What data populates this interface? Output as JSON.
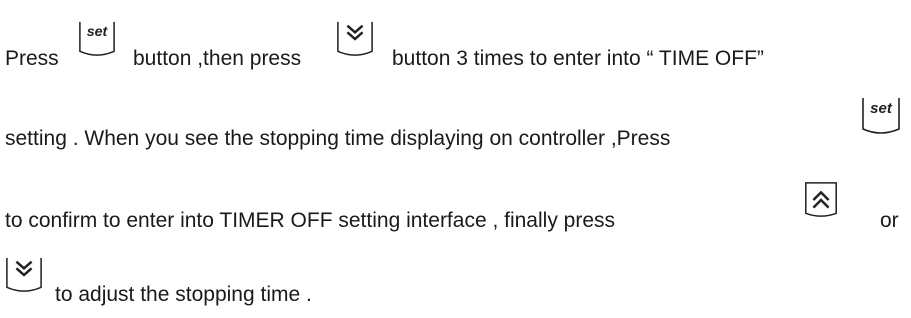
{
  "instruction": {
    "line1_part1": "Press",
    "line1_part2": "button ,then press",
    "line1_part3": "button 3 times to enter into “ TIME OFF”",
    "line2_part1": "setting . When you see the stopping time displaying on controller ,Press",
    "line3_part1": "to confirm to enter into TIMER OFF setting interface , finally press",
    "line3_part2": "or",
    "line4_part1": "to adjust the stopping time ."
  },
  "keys": {
    "set_label": "set",
    "set_icon": "set-key-icon",
    "down_icon": "double-chevron-down-key-icon",
    "up_icon": "double-chevron-up-key-icon"
  }
}
